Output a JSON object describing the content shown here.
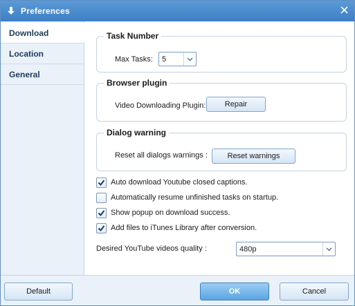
{
  "window": {
    "title": "Preferences",
    "accent": "#4a8ccf"
  },
  "sidebar": {
    "items": [
      {
        "label": "Download",
        "active": true
      },
      {
        "label": "Location",
        "active": false
      },
      {
        "label": "General",
        "active": false
      }
    ]
  },
  "task_number": {
    "title": "Task Number",
    "max_tasks_label": "Max Tasks:",
    "max_tasks_value": "5"
  },
  "browser_plugin": {
    "title": "Browser plugin",
    "plugin_label": "Video Downloading Plugin:",
    "repair_label": "Repair"
  },
  "dialog_warning": {
    "title": "Dialog warning",
    "reset_label": "Reset all dialogs warnings :",
    "reset_button": "Reset warnings"
  },
  "options": [
    {
      "label": "Auto download Youtube closed captions.",
      "checked": true
    },
    {
      "label": "Automatically resume unfinished  tasks on startup.",
      "checked": false
    },
    {
      "label": "Show popup on download success.",
      "checked": true
    },
    {
      "label": "Add files to iTunes Library after conversion.",
      "checked": true
    }
  ],
  "quality": {
    "label": "Desired YouTube videos quality :",
    "value": "480p"
  },
  "footer": {
    "default_label": "Default",
    "ok_label": "OK",
    "cancel_label": "Cancel"
  },
  "icons": {
    "app": "download-arrow-icon",
    "close": "close-icon",
    "checkmark": "checkmark-icon",
    "dropdown": "chevron-down-icon"
  }
}
